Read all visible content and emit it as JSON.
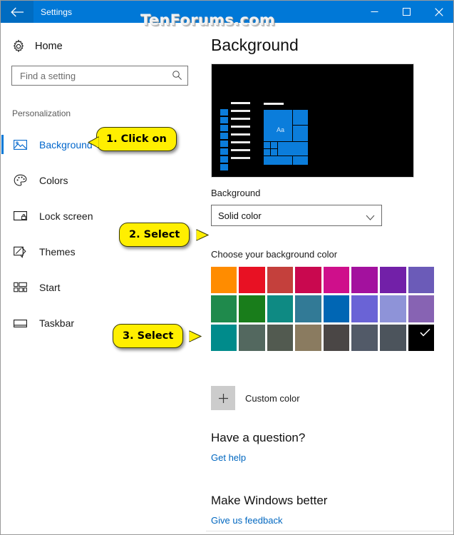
{
  "window": {
    "title": "Settings",
    "back_icon": "back-arrow-icon",
    "minimize_icon": "minimize-icon",
    "maximize_icon": "maximize-icon",
    "close_icon": "close-icon",
    "accent_color": "#0078d7"
  },
  "watermark": {
    "text": "TenForums.com"
  },
  "sidebar": {
    "home": {
      "label": "Home",
      "icon": "gear-icon"
    },
    "search": {
      "placeholder": "Find a setting",
      "value": "",
      "icon": "search-icon"
    },
    "group_label": "Personalization",
    "items": [
      {
        "label": "Background",
        "icon": "picture-icon",
        "selected": true
      },
      {
        "label": "Colors",
        "icon": "palette-icon",
        "selected": false
      },
      {
        "label": "Lock screen",
        "icon": "lock-screen-icon",
        "selected": false
      },
      {
        "label": "Themes",
        "icon": "themes-icon",
        "selected": false
      },
      {
        "label": "Start",
        "icon": "start-icon",
        "selected": false
      },
      {
        "label": "Taskbar",
        "icon": "taskbar-icon",
        "selected": false
      }
    ]
  },
  "main": {
    "page_title": "Background",
    "preview": {
      "name": "desktop-preview",
      "background_color": "#000000",
      "accent_color": "#0b7ddb",
      "tile_text": "Aa"
    },
    "background_field": {
      "label": "Background",
      "selected_value": "Solid color",
      "chevron_icon": "chevron-down-icon"
    },
    "color_section": {
      "label": "Choose your background color",
      "selected_index": 23,
      "check_icon": "checkmark-icon",
      "swatches": [
        "#ff8c00",
        "#e81123",
        "#c4403c",
        "#c9084f",
        "#cf0f8b",
        "#a3119e",
        "#7220a8",
        "#6b5bb8",
        "#1f8a4c",
        "#197d1b",
        "#0e8a83",
        "#327a96",
        "#0066b4",
        "#6a63d6",
        "#8e93d8",
        "#8763b3",
        "#008b8b",
        "#53685f",
        "#525a50",
        "#8a7b60",
        "#4a4645",
        "#525a68",
        "#4c545c",
        "#000000"
      ]
    },
    "custom_color": {
      "label": "Custom color",
      "icon": "plus-icon"
    },
    "help_section": {
      "heading": "Have a question?",
      "link": "Get help"
    },
    "feedback_section": {
      "heading": "Make Windows better",
      "link": "Give us feedback"
    }
  },
  "callouts": [
    {
      "text": "1. Click on",
      "tail": "left"
    },
    {
      "text": "2. Select",
      "tail": "right"
    },
    {
      "text": "3. Select",
      "tail": "right"
    }
  ]
}
